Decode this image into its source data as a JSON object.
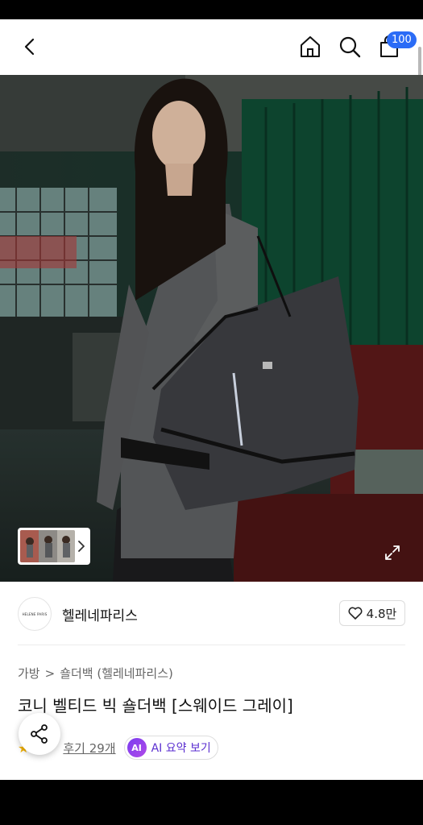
{
  "header": {
    "cart_count": "100",
    "icons": {
      "back": "chevron-left-icon",
      "home": "home-icon",
      "search": "search-icon",
      "cart": "cart-icon"
    }
  },
  "hero": {
    "expand_icon": "expand-icon",
    "thumbnail_next_icon": "chevron-right-icon"
  },
  "brand": {
    "logo_text": "HELENE PARIS",
    "name": "헬레네파리스",
    "like_count": "4.8만"
  },
  "breadcrumb": {
    "category": "가방",
    "separator": ">",
    "subcategory": "숄더백 (헬레네파리스)"
  },
  "product": {
    "title": "코니 벨티드 빅 숄더백 [스웨이드 그레이]"
  },
  "reviews": {
    "label": "후기 29개",
    "ai_badge": "AI",
    "ai_label": "AI 요약 보기"
  },
  "colors": {
    "accent_blue": "#2b6cf6",
    "ai_purple": "#7a3cf0",
    "star_yellow": "#f5b301"
  }
}
